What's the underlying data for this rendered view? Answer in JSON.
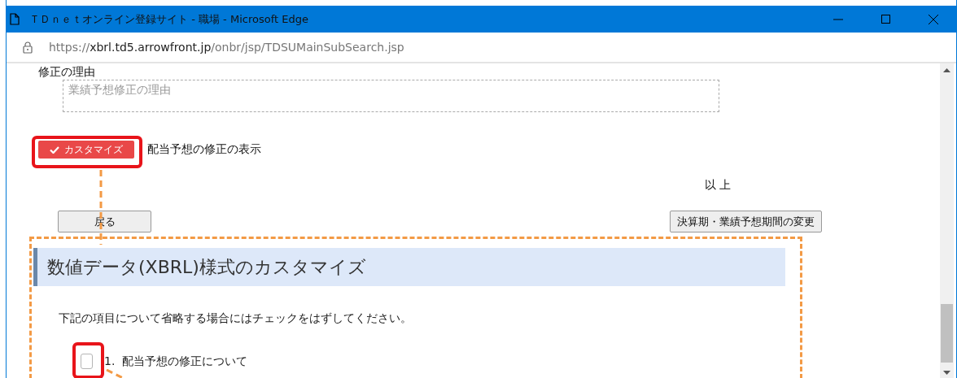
{
  "window": {
    "title": "ＴＤｎｅｔオンライン登録サイト - 職場 - Microsoft Edge"
  },
  "address_bar": {
    "url": {
      "scheme": "https://",
      "host": "xbrl.td5.arrowfront.jp",
      "path": "/onbr/jsp/TDSUMainSubSearch.jsp"
    }
  },
  "form": {
    "reason_label": "修正の理由",
    "reason_field": {
      "placeholder": "業績予想修正の理由"
    },
    "customize_toggle": {
      "label": "カスタマイズ",
      "checked": true
    },
    "customize_caption": "配当予想の修正の表示",
    "closing": "以 上",
    "buttons": [
      {
        "kind": "back",
        "label": "戻る"
      },
      {
        "kind": "change",
        "label": "決算期・業績予想期間の変更"
      }
    ]
  },
  "customize_panel": {
    "heading": "数値データ(XBRL)様式のカスタマイズ",
    "instruction": "下記の項目について省略する場合にはチェックをはずしてください。",
    "items": [
      {
        "label": "1.  配当予想の修正について",
        "checked": false
      }
    ]
  }
}
